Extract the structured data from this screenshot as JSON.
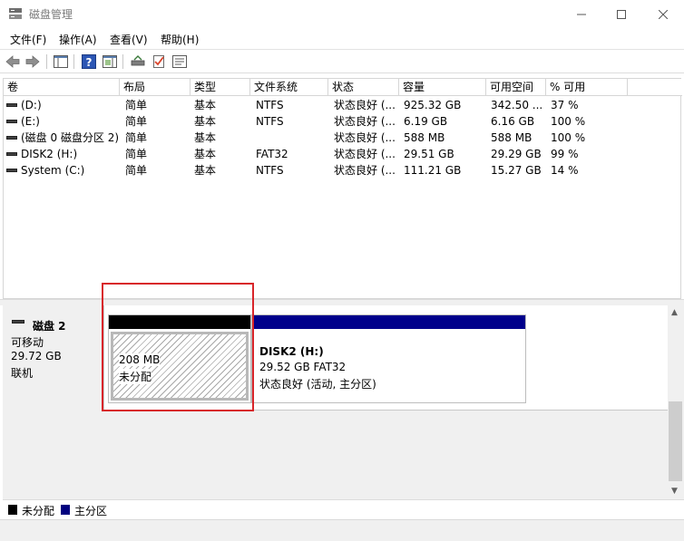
{
  "window": {
    "title": "磁盘管理"
  },
  "menu": [
    "文件(F)",
    "操作(A)",
    "查看(V)",
    "帮助(H)"
  ],
  "volume_table": {
    "columns": [
      "卷",
      "布局",
      "类型",
      "文件系统",
      "状态",
      "容量",
      "可用空间",
      "% 可用"
    ],
    "rows": [
      [
        "(D:)",
        "简单",
        "基本",
        "NTFS",
        "状态良好 (...",
        "925.32 GB",
        "342.50 ...",
        "37 %"
      ],
      [
        "(E:)",
        "简单",
        "基本",
        "NTFS",
        "状态良好 (...",
        "6.19 GB",
        "6.16 GB",
        "100 %"
      ],
      [
        "(磁盘 0 磁盘分区 2)",
        "简单",
        "基本",
        "",
        "状态良好 (...",
        "588 MB",
        "588 MB",
        "100 %"
      ],
      [
        "DISK2 (H:)",
        "简单",
        "基本",
        "FAT32",
        "状态良好 (...",
        "29.51 GB",
        "29.29 GB",
        "99 %"
      ],
      [
        "System (C:)",
        "简单",
        "基本",
        "NTFS",
        "状态良好 (...",
        "111.21 GB",
        "15.27 GB",
        "14 %"
      ]
    ]
  },
  "disk": {
    "name": "磁盘 2",
    "type": "可移动",
    "size": "29.72 GB",
    "state": "联机",
    "partitions": [
      {
        "size": "208 MB",
        "label": "未分配",
        "bar_color": "#000000"
      },
      {
        "name": "DISK2  (H:)",
        "detail": "29.52 GB FAT32",
        "status": "状态良好 (活动, 主分区)",
        "bar_color": "#00008b"
      }
    ]
  },
  "legend": [
    {
      "label": "未分配",
      "color": "#000000"
    },
    {
      "label": "主分区",
      "color": "#00007f"
    }
  ],
  "colors": {
    "selection_outline": "#d8252a"
  }
}
